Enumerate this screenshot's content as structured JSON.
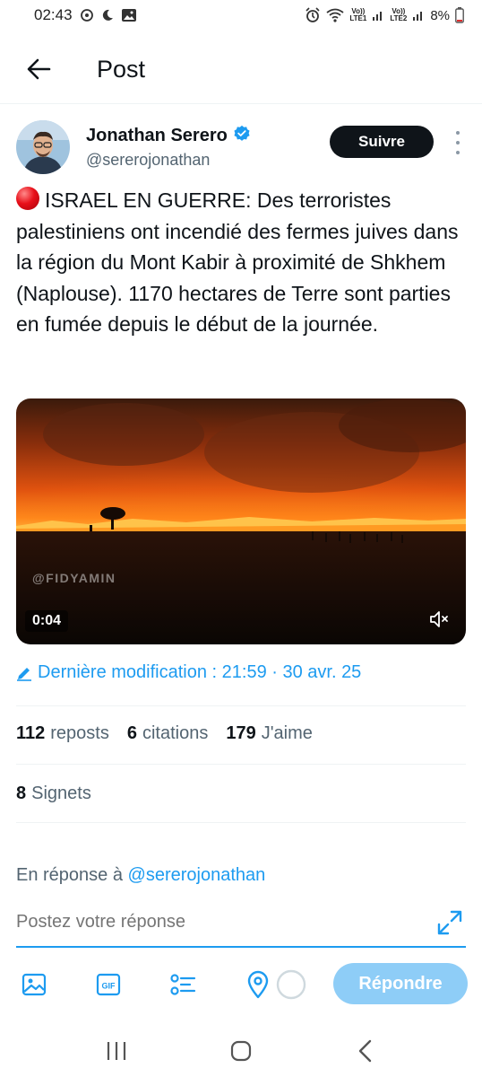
{
  "status_bar": {
    "time": "02:43",
    "battery": "8%",
    "sim1": "LTE1",
    "sim2": "LTE2",
    "volte": "Vo))"
  },
  "header": {
    "title": "Post"
  },
  "author": {
    "name": "Jonathan Serero",
    "handle": "@sererojonathan",
    "follow_label": "Suivre"
  },
  "tweet": {
    "text": "ISRAEL EN GUERRE: Des terroristes palestiniens ont incendié des fermes juives dans la région du Mont Kabir à proximité de Shkhem (Naplouse). 1170 hectares de Terre sont parties en fumée depuis le début de la journée."
  },
  "media": {
    "watermark": "@FIDYAMIN",
    "duration": "0:04"
  },
  "edited": {
    "label": "Dernière modification : 21:59 · 30 avr. 25"
  },
  "stats": {
    "reposts_count": "112",
    "reposts_label": "reposts",
    "quotes_count": "6",
    "quotes_label": "citations",
    "likes_count": "179",
    "likes_label": "J'aime",
    "bookmarks_count": "8",
    "bookmarks_label": "Signets"
  },
  "reply": {
    "reply_to_prefix": "En réponse à",
    "reply_to_handle": "@sererojonathan",
    "placeholder": "Postez votre réponse",
    "submit_label": "Répondre"
  },
  "colors": {
    "accent": "#1d9bf0",
    "text": "#0f1419",
    "muted": "#536471",
    "reply_button": "#8ecdf7"
  }
}
